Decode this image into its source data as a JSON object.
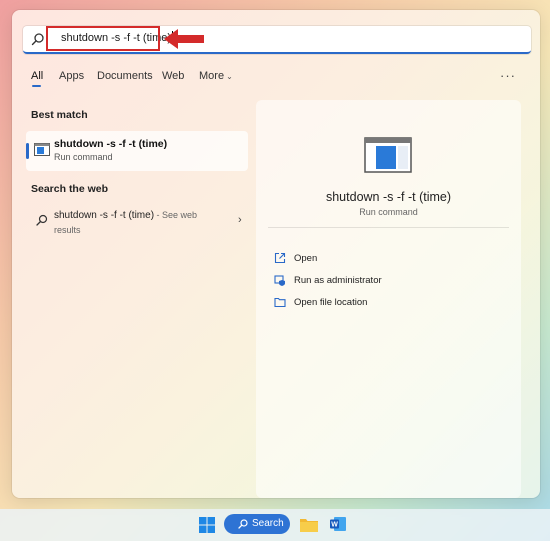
{
  "search": {
    "query": "shutdown -s -f -t (time)"
  },
  "tabs": [
    {
      "label": "All"
    },
    {
      "label": "Apps"
    },
    {
      "label": "Documents"
    },
    {
      "label": "Web"
    },
    {
      "label": "More"
    }
  ],
  "best_match": {
    "heading": "Best match",
    "title": "shutdown -s -f -t (time)",
    "subtitle": "Run command"
  },
  "web": {
    "heading": "Search the web",
    "title": "shutdown -s -f -t (time)",
    "see": " - See web",
    "results": "results"
  },
  "detail": {
    "title": "shutdown -s -f -t (time)",
    "subtitle": "Run command",
    "actions": [
      {
        "label": "Open",
        "icon": "open-external-icon"
      },
      {
        "label": "Run as administrator",
        "icon": "shield-admin-icon"
      },
      {
        "label": "Open file location",
        "icon": "folder-icon"
      }
    ]
  },
  "taskbar": {
    "search_label": "Search"
  },
  "colors": {
    "accent": "#2a69c8",
    "highlight": "#d42a2a",
    "pill": "#2e73d4"
  }
}
